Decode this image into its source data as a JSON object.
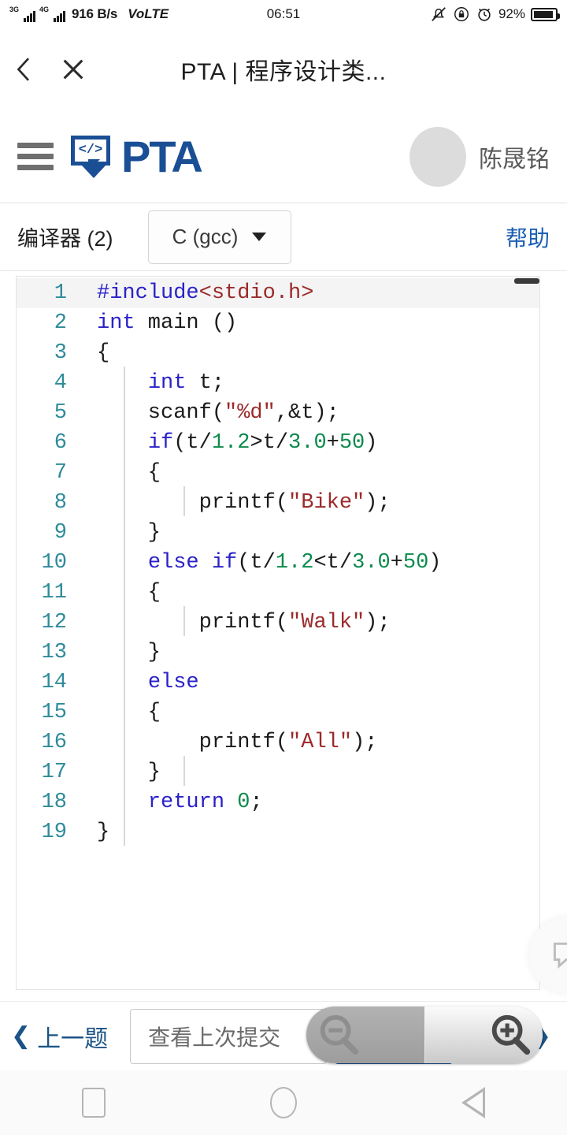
{
  "status_bar": {
    "network_tag_1": "3G",
    "network_tag_2": "4G",
    "speed": "916 B/s",
    "volte": "VoLTE",
    "time": "06:51",
    "battery_percent": "92%",
    "icons": [
      "mute-icon",
      "rotation-lock-icon",
      "alarm-icon",
      "battery-icon"
    ]
  },
  "title_bar": {
    "back_icon": "chevron-left-icon",
    "close_icon": "close-icon",
    "title": "PTA | 程序设计类..."
  },
  "app_header": {
    "menu_icon": "hamburger-menu-icon",
    "logo_glyph": "</>",
    "logo_text": "PTA",
    "user_name": "陈晟铭",
    "brand_color": "#1a4f95"
  },
  "toolbar": {
    "compiler_label": "编译器 (2)",
    "compiler_select_value": "C (gcc)",
    "compiler_options": [
      "C (gcc)"
    ],
    "help_label": "帮助",
    "link_color": "#1a5fb4"
  },
  "editor": {
    "active_line": 1,
    "lines": [
      {
        "n": "1",
        "tokens": [
          {
            "t": "#include",
            "c": "pp"
          },
          {
            "t": "<stdio.h>",
            "c": "inc"
          }
        ]
      },
      {
        "n": "2",
        "tokens": [
          {
            "t": "int",
            "c": "kw"
          },
          {
            "t": " main ()",
            "c": ""
          }
        ]
      },
      {
        "n": "3",
        "tokens": [
          {
            "t": "{",
            "c": ""
          }
        ]
      },
      {
        "n": "4",
        "tokens": [
          {
            "t": "    ",
            "c": ""
          },
          {
            "t": "int",
            "c": "kw"
          },
          {
            "t": " t;",
            "c": ""
          }
        ]
      },
      {
        "n": "5",
        "tokens": [
          {
            "t": "    scanf(",
            "c": ""
          },
          {
            "t": "\"%d\"",
            "c": "str"
          },
          {
            "t": ",&t);",
            "c": ""
          }
        ]
      },
      {
        "n": "6",
        "tokens": [
          {
            "t": "    ",
            "c": ""
          },
          {
            "t": "if",
            "c": "kw"
          },
          {
            "t": "(t/",
            "c": ""
          },
          {
            "t": "1.2",
            "c": "num"
          },
          {
            "t": ">t/",
            "c": ""
          },
          {
            "t": "3.0",
            "c": "num"
          },
          {
            "t": "+",
            "c": ""
          },
          {
            "t": "50",
            "c": "num"
          },
          {
            "t": ")",
            "c": ""
          }
        ]
      },
      {
        "n": "7",
        "tokens": [
          {
            "t": "    {",
            "c": ""
          }
        ]
      },
      {
        "n": "8",
        "tokens": [
          {
            "t": "        printf(",
            "c": ""
          },
          {
            "t": "\"Bike\"",
            "c": "str"
          },
          {
            "t": ");",
            "c": ""
          }
        ]
      },
      {
        "n": "9",
        "tokens": [
          {
            "t": "    }",
            "c": ""
          }
        ]
      },
      {
        "n": "10",
        "tokens": [
          {
            "t": "    ",
            "c": ""
          },
          {
            "t": "else",
            "c": "kw"
          },
          {
            "t": " ",
            "c": ""
          },
          {
            "t": "if",
            "c": "kw"
          },
          {
            "t": "(t/",
            "c": ""
          },
          {
            "t": "1.2",
            "c": "num"
          },
          {
            "t": "<t/",
            "c": ""
          },
          {
            "t": "3.0",
            "c": "num"
          },
          {
            "t": "+",
            "c": ""
          },
          {
            "t": "50",
            "c": "num"
          },
          {
            "t": ")",
            "c": ""
          }
        ]
      },
      {
        "n": "11",
        "tokens": [
          {
            "t": "    {",
            "c": ""
          }
        ]
      },
      {
        "n": "12",
        "tokens": [
          {
            "t": "        printf(",
            "c": ""
          },
          {
            "t": "\"Walk\"",
            "c": "str"
          },
          {
            "t": ");",
            "c": ""
          }
        ]
      },
      {
        "n": "13",
        "tokens": [
          {
            "t": "    }",
            "c": ""
          }
        ]
      },
      {
        "n": "14",
        "tokens": [
          {
            "t": "    ",
            "c": ""
          },
          {
            "t": "else",
            "c": "kw"
          }
        ]
      },
      {
        "n": "15",
        "tokens": [
          {
            "t": "    {",
            "c": ""
          }
        ]
      },
      {
        "n": "16",
        "tokens": [
          {
            "t": "        printf(",
            "c": ""
          },
          {
            "t": "\"All\"",
            "c": "str"
          },
          {
            "t": ");",
            "c": ""
          }
        ]
      },
      {
        "n": "17",
        "tokens": [
          {
            "t": "    }",
            "c": ""
          }
        ]
      },
      {
        "n": "18",
        "tokens": [
          {
            "t": "    ",
            "c": ""
          },
          {
            "t": "return",
            "c": "kw"
          },
          {
            "t": " ",
            "c": ""
          },
          {
            "t": "0",
            "c": "num"
          },
          {
            "t": ";",
            "c": ""
          }
        ]
      },
      {
        "n": "19",
        "tokens": [
          {
            "t": "}",
            "c": ""
          }
        ]
      }
    ],
    "colors": {
      "line_number": "#2e8b9a",
      "keyword": "#2a22c8",
      "string": "#9c2a2a",
      "number": "#0b8a4b",
      "text": "#1b1b1b"
    }
  },
  "feedback_button": {
    "icon": "speech-bubble-icon"
  },
  "bottom_bar": {
    "prev_label": "上一题",
    "prev_icon": "chevron-left-icon",
    "last_submission_label": "查看上次提交",
    "next_icon": "chevron-right-icon",
    "accent_color": "#1a5396"
  },
  "zoom_control": {
    "zoom_out_icon": "magnifier-minus-icon",
    "zoom_in_icon": "magnifier-plus-icon"
  },
  "nav_bar": {
    "recents_icon": "square-icon",
    "home_icon": "circle-icon",
    "back_icon": "triangle-left-icon"
  }
}
